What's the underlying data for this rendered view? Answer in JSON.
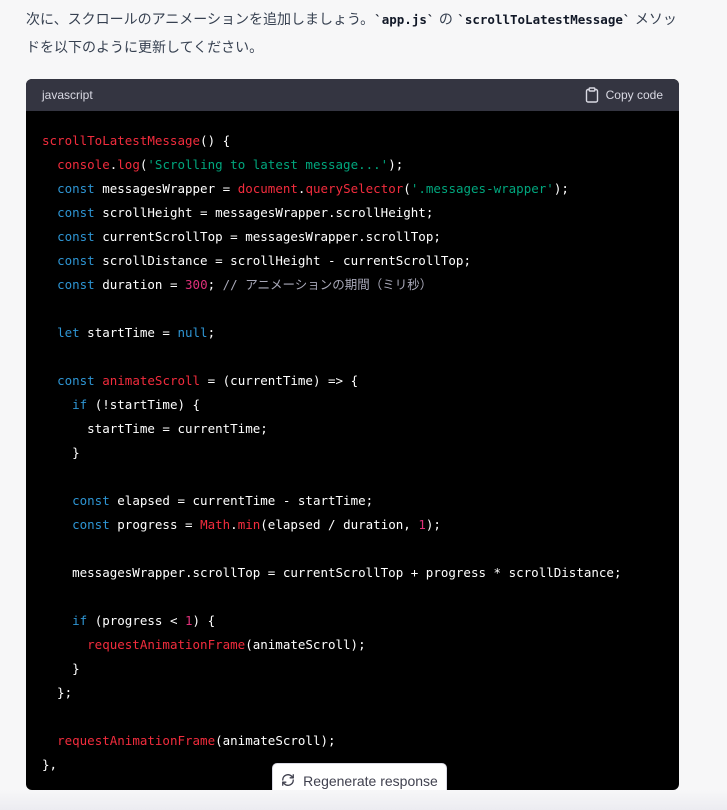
{
  "message": {
    "intro_part1": "次に、スクロールのアニメーションを追加しましょう。",
    "intro_code1": "`app.js`",
    "intro_part2": " の ",
    "intro_code2": "`scrollToLatestMessage`",
    "intro_part3": " メソッドを以下のように更新してください。"
  },
  "code_block": {
    "language": "javascript",
    "copy_label": "Copy code",
    "lines": [
      [
        {
          "t": "scrollToLatestMessage",
          "c": "f"
        },
        {
          "t": "() {"
        }
      ],
      [
        {
          "t": "  "
        },
        {
          "t": "console",
          "c": "f"
        },
        {
          "t": "."
        },
        {
          "t": "log",
          "c": "f"
        },
        {
          "t": "("
        },
        {
          "t": "'Scrolling to latest message...'",
          "c": "s"
        },
        {
          "t": ");"
        }
      ],
      [
        {
          "t": "  "
        },
        {
          "t": "const",
          "c": "k"
        },
        {
          "t": " messagesWrapper = "
        },
        {
          "t": "document",
          "c": "f"
        },
        {
          "t": "."
        },
        {
          "t": "querySelector",
          "c": "f"
        },
        {
          "t": "("
        },
        {
          "t": "'.messages-wrapper'",
          "c": "s"
        },
        {
          "t": ");"
        }
      ],
      [
        {
          "t": "  "
        },
        {
          "t": "const",
          "c": "k"
        },
        {
          "t": " scrollHeight = messagesWrapper.scrollHeight;"
        }
      ],
      [
        {
          "t": "  "
        },
        {
          "t": "const",
          "c": "k"
        },
        {
          "t": " currentScrollTop = messagesWrapper.scrollTop;"
        }
      ],
      [
        {
          "t": "  "
        },
        {
          "t": "const",
          "c": "k"
        },
        {
          "t": " scrollDistance = scrollHeight - currentScrollTop;"
        }
      ],
      [
        {
          "t": "  "
        },
        {
          "t": "const",
          "c": "k"
        },
        {
          "t": " duration = "
        },
        {
          "t": "300",
          "c": "n"
        },
        {
          "t": "; "
        },
        {
          "t": "// アニメーションの期間（ミリ秒）",
          "c": "c"
        }
      ],
      [
        {
          "t": ""
        }
      ],
      [
        {
          "t": "  "
        },
        {
          "t": "let",
          "c": "k"
        },
        {
          "t": " startTime = "
        },
        {
          "t": "null",
          "c": "k"
        },
        {
          "t": ";"
        }
      ],
      [
        {
          "t": ""
        }
      ],
      [
        {
          "t": "  "
        },
        {
          "t": "const",
          "c": "k"
        },
        {
          "t": " "
        },
        {
          "t": "animateScroll",
          "c": "f"
        },
        {
          "t": " = (currentTime) => {"
        }
      ],
      [
        {
          "t": "    "
        },
        {
          "t": "if",
          "c": "k"
        },
        {
          "t": " (!startTime) {"
        }
      ],
      [
        {
          "t": "      startTime = currentTime;"
        }
      ],
      [
        {
          "t": "    }"
        }
      ],
      [
        {
          "t": ""
        }
      ],
      [
        {
          "t": "    "
        },
        {
          "t": "const",
          "c": "k"
        },
        {
          "t": " elapsed = currentTime - startTime;"
        }
      ],
      [
        {
          "t": "    "
        },
        {
          "t": "const",
          "c": "k"
        },
        {
          "t": " progress = "
        },
        {
          "t": "Math",
          "c": "f"
        },
        {
          "t": "."
        },
        {
          "t": "min",
          "c": "f"
        },
        {
          "t": "(elapsed / duration, "
        },
        {
          "t": "1",
          "c": "n"
        },
        {
          "t": ");"
        }
      ],
      [
        {
          "t": ""
        }
      ],
      [
        {
          "t": "    messagesWrapper.scrollTop = currentScrollTop + progress * scrollDistance;"
        }
      ],
      [
        {
          "t": ""
        }
      ],
      [
        {
          "t": "    "
        },
        {
          "t": "if",
          "c": "k"
        },
        {
          "t": " (progress < "
        },
        {
          "t": "1",
          "c": "n"
        },
        {
          "t": ") {"
        }
      ],
      [
        {
          "t": "      "
        },
        {
          "t": "requestAnimationFrame",
          "c": "f"
        },
        {
          "t": "(animateScroll);"
        }
      ],
      [
        {
          "t": "    }"
        }
      ],
      [
        {
          "t": "  };"
        }
      ],
      [
        {
          "t": ""
        }
      ],
      [
        {
          "t": "  "
        },
        {
          "t": "requestAnimationFrame",
          "c": "f"
        },
        {
          "t": "(animateScroll);"
        }
      ],
      [
        {
          "t": "},"
        }
      ]
    ]
  },
  "regenerate": {
    "label": "Regenerate response",
    "icon": "refresh-icon"
  },
  "colors": {
    "code_bg": "#000000",
    "code_header_bg": "#343541",
    "keyword": "#2e95d3",
    "function": "#f22c3d",
    "string": "#00a67d",
    "number": "#df3079",
    "comment": "#a8a8b8"
  }
}
